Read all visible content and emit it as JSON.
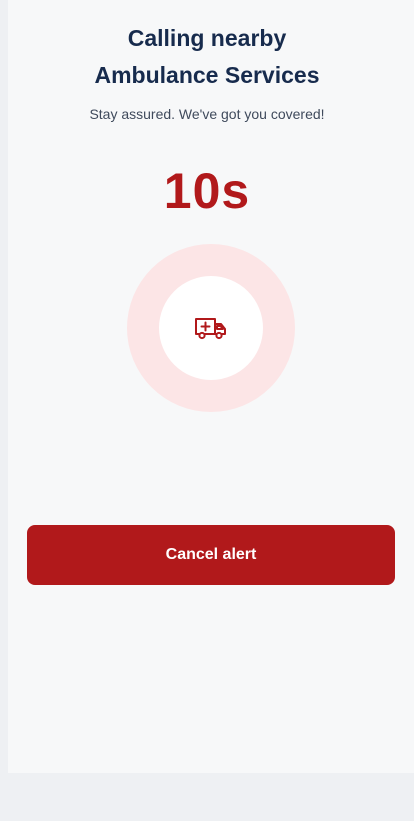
{
  "header": {
    "title_line1": "Calling nearby",
    "title_line2": "Ambulance Services",
    "subtitle": "Stay assured. We've got you covered!"
  },
  "countdown": {
    "value": "10s"
  },
  "status_indicator": {
    "icon": "ambulance-icon",
    "accent_color": "#b1191b",
    "ring_color": "#fce5e6"
  },
  "actions": {
    "cancel_label": "Cancel alert"
  }
}
